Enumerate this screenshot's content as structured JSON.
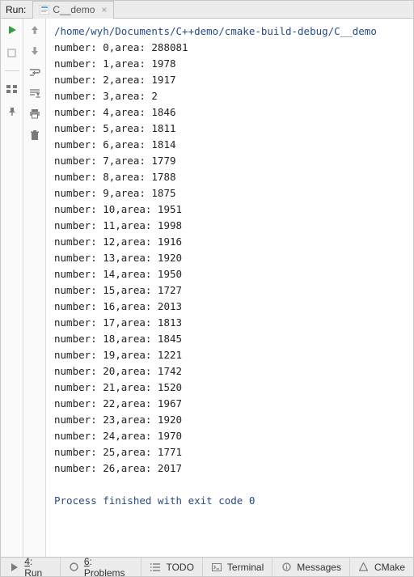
{
  "header": {
    "run_label": "Run:",
    "tab_label": "C__demo",
    "close_glyph": "×"
  },
  "console": {
    "command_line": "/home/wyh/Documents/C++demo/cmake-build-debug/C__demo",
    "lines": [
      "number: 0,area: 288081",
      "number: 1,area: 1978",
      "number: 2,area: 1917",
      "number: 3,area: 2",
      "number: 4,area: 1846",
      "number: 5,area: 1811",
      "number: 6,area: 1814",
      "number: 7,area: 1779",
      "number: 8,area: 1788",
      "number: 9,area: 1875",
      "number: 10,area: 1951",
      "number: 11,area: 1998",
      "number: 12,area: 1916",
      "number: 13,area: 1920",
      "number: 14,area: 1950",
      "number: 15,area: 1727",
      "number: 16,area: 2013",
      "number: 17,area: 1813",
      "number: 18,area: 1845",
      "number: 19,area: 1221",
      "number: 20,area: 1742",
      "number: 21,area: 1520",
      "number: 22,area: 1967",
      "number: 23,area: 1920",
      "number: 24,area: 1970",
      "number: 25,area: 1771",
      "number: 26,area: 2017"
    ],
    "exit_line": "Process finished with exit code 0"
  },
  "footer": {
    "tabs": [
      {
        "key": "4",
        "label": ": Run"
      },
      {
        "key": "6",
        "label": ": Problems"
      },
      {
        "key": "",
        "label": "TODO"
      },
      {
        "key": "",
        "label": "Terminal"
      },
      {
        "key": "",
        "label": "Messages"
      },
      {
        "key": "",
        "label": "CMake"
      }
    ]
  }
}
